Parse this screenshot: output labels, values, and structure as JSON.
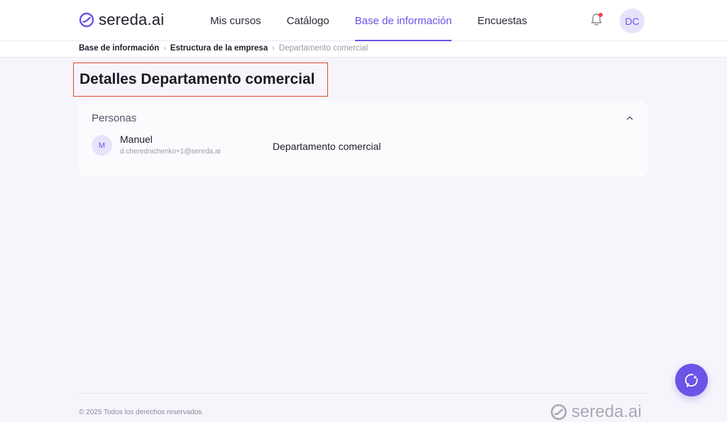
{
  "brand": {
    "name": "sereda.ai",
    "accent": "#6b54e6"
  },
  "nav": {
    "items": [
      {
        "label": "Mis cursos",
        "active": false
      },
      {
        "label": "Catálogo",
        "active": false
      },
      {
        "label": "Base de información",
        "active": true
      },
      {
        "label": "Encuestas",
        "active": false
      }
    ]
  },
  "header": {
    "notification_icon": "bell-icon",
    "user_initials": "DC"
  },
  "breadcrumb": {
    "items": [
      "Base de información",
      "Estructura de la empresa",
      "Departamento comercial"
    ]
  },
  "page": {
    "title": "Detalles Departamento comercial"
  },
  "people_section": {
    "title": "Personas",
    "expanded": true,
    "people": [
      {
        "initial": "M",
        "name": "Manuel",
        "email": "d.cherednichenko+1@sereda.ai",
        "department": "Departamento comercial"
      }
    ]
  },
  "footer": {
    "copyright": "© 2025 Todos los derechos reservados",
    "logo_text": "sereda.ai"
  },
  "assistant_button_icon": "ai-sparkle-icon"
}
